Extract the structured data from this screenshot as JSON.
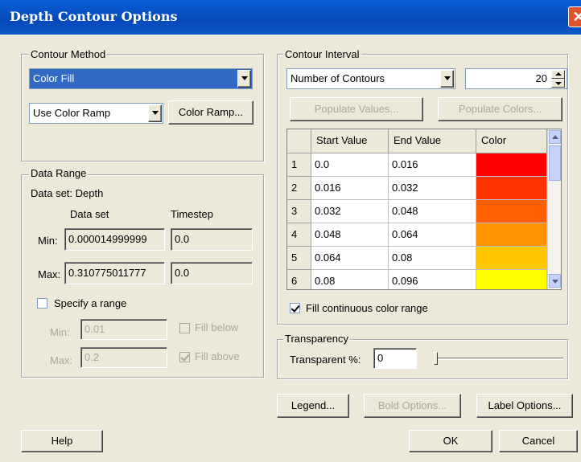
{
  "window": {
    "title": "Depth Contour Options"
  },
  "contour_method": {
    "group_label": "Contour Method",
    "method_value": "Color Fill",
    "ramp_value": "Use Color Ramp",
    "color_ramp_button": "Color Ramp..."
  },
  "data_range": {
    "group_label": "Data Range",
    "dataset_line": "Data set:  Depth",
    "col_dataset": "Data set",
    "col_timestep": "Timestep",
    "min_label": "Min:",
    "max_label": "Max:",
    "min_dataset": "0.000014999999",
    "min_timestep": "0.0",
    "max_dataset": "0.310775011777",
    "max_timestep": "0.0",
    "specify_label": "Specify a range",
    "range_min_label": "Min:",
    "range_min_value": "0.01",
    "range_max_label": "Max:",
    "range_max_value": "0.2",
    "fill_below": "Fill below",
    "fill_above": "Fill above"
  },
  "contour_interval": {
    "group_label": "Contour Interval",
    "mode_value": "Number of Contours",
    "count_value": "20",
    "populate_values": "Populate Values...",
    "populate_colors": "Populate Colors...",
    "headers": {
      "start": "Start Value",
      "end": "End Value",
      "color": "Color"
    },
    "rows": [
      {
        "n": "1",
        "start": "0.0",
        "end": "0.016",
        "color": "#ff0000"
      },
      {
        "n": "2",
        "start": "0.016",
        "end": "0.032",
        "color": "#ff3300"
      },
      {
        "n": "3",
        "start": "0.032",
        "end": "0.048",
        "color": "#ff5f00"
      },
      {
        "n": "4",
        "start": "0.048",
        "end": "0.064",
        "color": "#ff9400"
      },
      {
        "n": "5",
        "start": "0.064",
        "end": "0.08",
        "color": "#ffc800"
      },
      {
        "n": "6",
        "start": "0.08",
        "end": "0.096",
        "color": "#ffff00"
      }
    ],
    "fill_continuous": "Fill continuous color range"
  },
  "transparency": {
    "group_label": "Transparency",
    "label": "Transparent %:",
    "value": "0"
  },
  "buttons": {
    "legend": "Legend...",
    "bold_options": "Bold Options...",
    "label_options": "Label Options...",
    "help": "Help",
    "ok": "OK",
    "cancel": "Cancel"
  }
}
